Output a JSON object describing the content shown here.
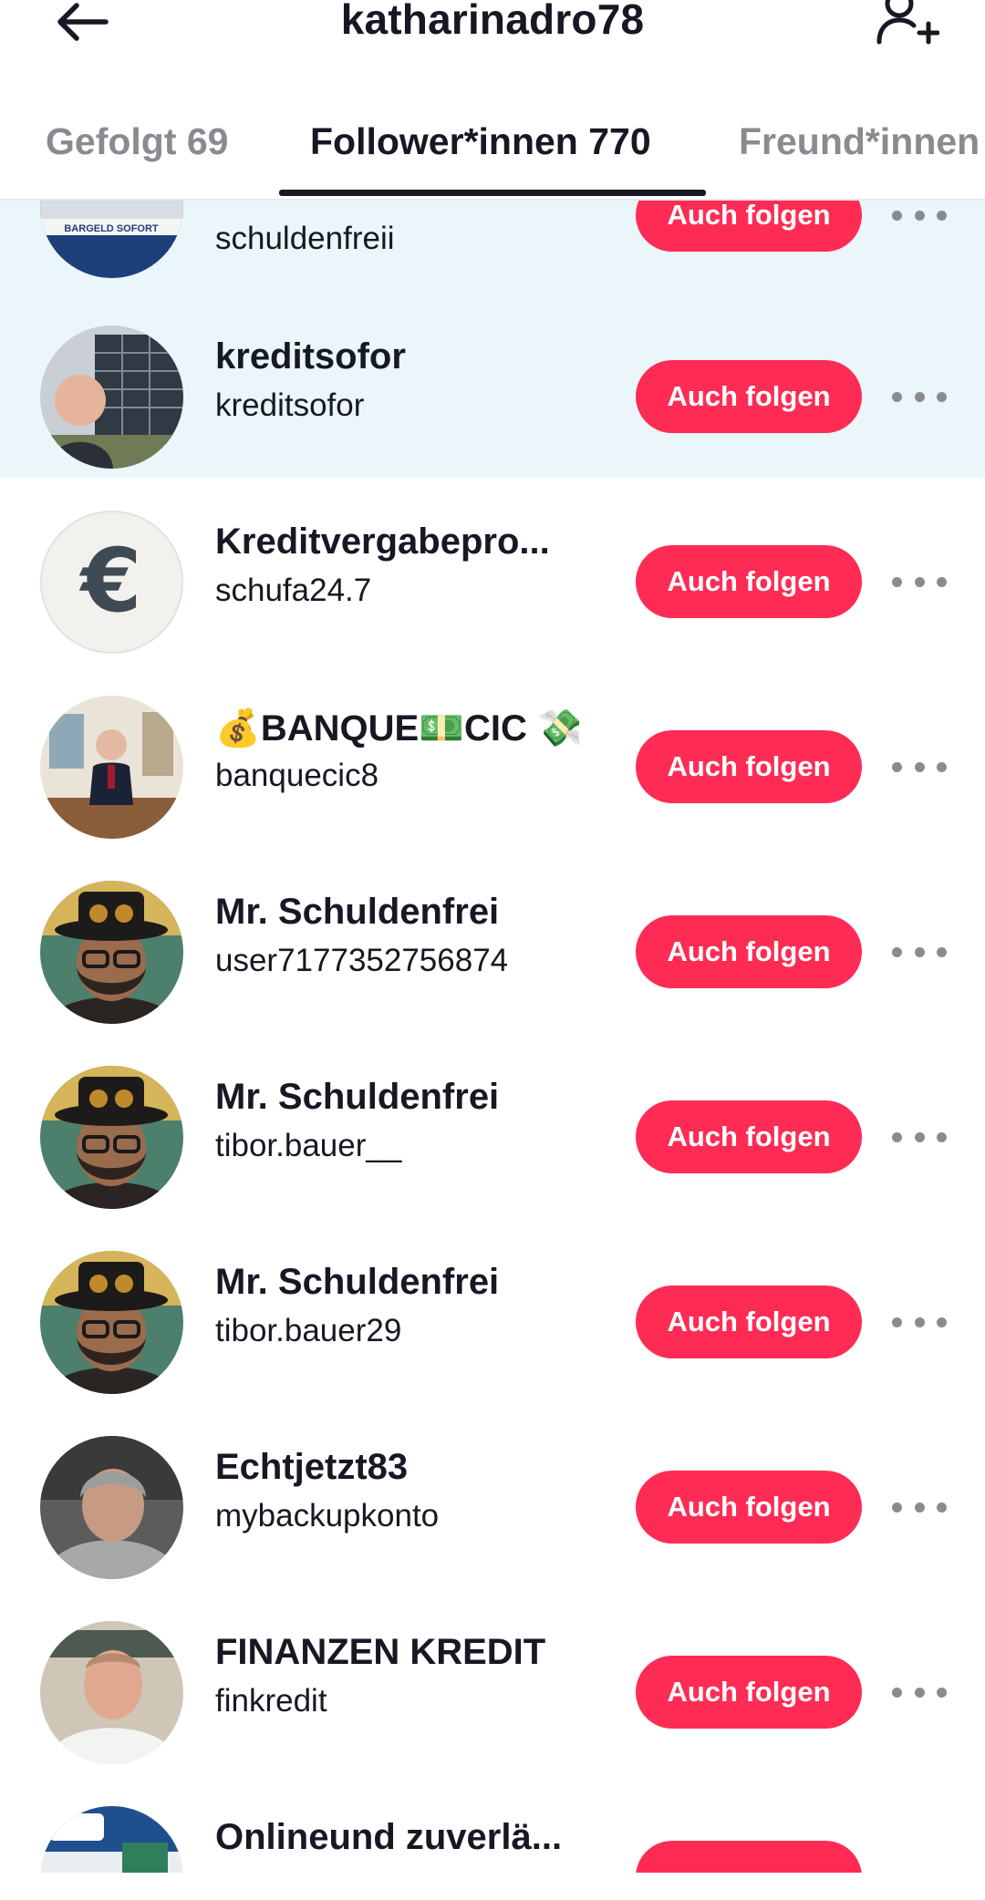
{
  "header": {
    "title": "katharinadro78",
    "back_icon": "arrow-left-icon",
    "add_icon": "person-add-icon"
  },
  "tabs": [
    {
      "label": "Gefolgt 69",
      "active": false
    },
    {
      "label": "Follower*innen 770",
      "active": true
    },
    {
      "label": "Freund*innen",
      "active": false
    }
  ],
  "button_label": "Auch folgen",
  "colors": {
    "accent": "#fe2c55",
    "highlight_row": "#eaf6f9",
    "text": "#161823",
    "muted": "#8a8b91"
  },
  "followers": [
    {
      "name": "schuldenfreii",
      "handle": "schuldenfreii",
      "avatar": "bargeld-banner-avatar"
    },
    {
      "name": "kreditsofor",
      "handle": "kreditsofor",
      "avatar": "man-building-avatar"
    },
    {
      "name": "Kreditvergabepro...",
      "handle": "schufa24.7",
      "avatar": "euro-sign-avatar"
    },
    {
      "name": "BANQUE",
      "name_emoji_prefix": "💰",
      "name_emoji_mid": "💵",
      "name_suffix": "CIC",
      "name_emoji_suffix": "💸",
      "handle": "banquecic8",
      "avatar": "office-man-avatar"
    },
    {
      "name": "Mr. Schuldenfrei",
      "handle": "user7177352756874",
      "avatar": "hat-man-avatar"
    },
    {
      "name": "Mr. Schuldenfrei",
      "handle": "tibor.bauer__",
      "avatar": "hat-man-avatar"
    },
    {
      "name": "Mr. Schuldenfrei",
      "handle": "tibor.bauer29",
      "avatar": "hat-man-avatar"
    },
    {
      "name": "Echtjetzt83",
      "handle": "mybackupkonto",
      "avatar": "hoodie-man-avatar"
    },
    {
      "name": "FINANZEN KREDIT",
      "handle": "finkredit",
      "avatar": "bald-man-avatar"
    },
    {
      "name": "Onlineund zuverlä...",
      "handle": "",
      "avatar": "ad-banner-avatar"
    }
  ]
}
